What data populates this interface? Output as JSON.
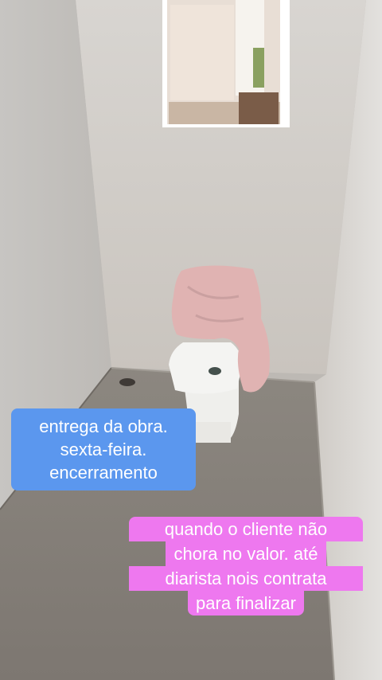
{
  "captions": {
    "blue": {
      "lines": [
        "entrega da obra.",
        "sexta-feira.",
        "encerramento"
      ],
      "color": "#5b97ee"
    },
    "pink": {
      "lines": [
        "quando o cliente não",
        "chora no valor. até",
        "diarista nois contrata",
        "para finalizar"
      ],
      "color": "#ee78ef"
    }
  },
  "scene": {
    "subject": "toilet-with-pink-cloth",
    "colors": {
      "wall": "#cfcbc6",
      "floor": "#8a847d",
      "window_light": "#f6f3ee",
      "cloth": "#e3b4b3",
      "toilet": "#f2f2f0"
    }
  }
}
